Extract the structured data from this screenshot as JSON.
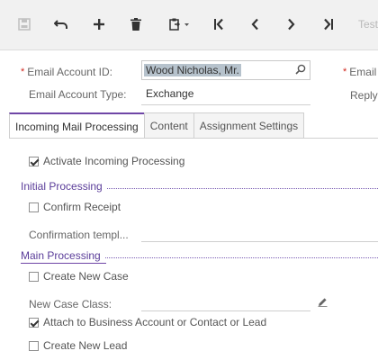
{
  "toolbar": {
    "icons": [
      "save-icon",
      "undo-icon",
      "add-icon",
      "delete-icon",
      "clipboard-icon",
      "first-icon",
      "previous-icon",
      "next-icon",
      "last-icon"
    ],
    "test_label": "Test"
  },
  "header": {
    "email_account_id_label": "Email Account ID:",
    "email_account_id_value": "Wood Nicholas, Mr.",
    "email_account_type_label": "Email Account Type:",
    "email_account_type_value": "Exchange",
    "right_email_label": "Email",
    "right_reply_label": "Reply"
  },
  "tabs": [
    "Incoming Mail Processing",
    "Content",
    "Assignment Settings"
  ],
  "active_tab": 0,
  "incoming": {
    "activate_label": "Activate Incoming Processing",
    "activate_checked": true
  },
  "initial_processing": {
    "title": "Initial Processing",
    "confirm_receipt_label": "Confirm Receipt",
    "confirm_receipt_checked": false,
    "confirmation_template_label": "Confirmation templ..."
  },
  "main_processing": {
    "title": "Main Processing",
    "create_case_label": "Create New Case",
    "create_case_checked": false,
    "new_case_class_label": "New Case Class:",
    "attach_label": "Attach to Business Account or Contact or Lead",
    "attach_checked": true,
    "create_lead_label": "Create New Lead",
    "create_lead_checked": false
  },
  "colors": {
    "accent": "#6f46a6",
    "required": "#d0271d",
    "toolbar_bg": "#f1f1f1"
  }
}
